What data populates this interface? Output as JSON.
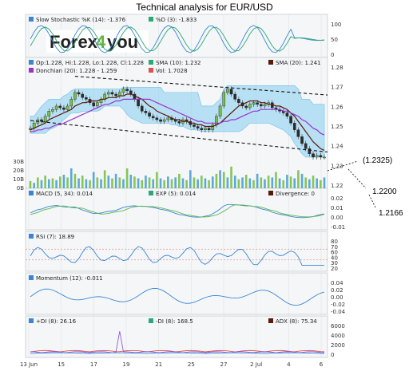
{
  "title": "Technical analysis for EUR/USD",
  "logo": "Forex4you",
  "colors": {
    "candle_up": "#7ac142",
    "candle_down": "#2b2b2b",
    "sma10": "#5a1a0a",
    "sma20": "#9933cc",
    "donchian": "#87cdf0",
    "volume": "#4aa0d8",
    "line_blue": "#3a86d4",
    "rsi_red": "#e06060",
    "panel_bg": "#f4f6f8"
  },
  "panels": {
    "stoch": {
      "legend": [
        "Slow Stochastic %K (14): -1.376",
        "%D (3): -1.833"
      ],
      "ticks": [
        "100",
        "50",
        "0"
      ]
    },
    "price": {
      "legend": [
        "Op:1.228, Hi:1.228, Lo:1.228, Cl:1.228",
        "SMA (10): 1.232",
        "SMA (20): 1.241",
        "Donchian (20): 1.228 - 1.259",
        "Vol: 1.7028"
      ],
      "ticks": [
        "1.28",
        "1.27",
        "1.26",
        "1.25",
        "1.24",
        "1.23",
        "1.22"
      ],
      "vol_ticks": [
        "30B",
        "20B",
        "10B",
        "0B"
      ]
    },
    "macd": {
      "legend": [
        "MACD (5, 34): 0.014",
        "EXP (5): 0.014",
        "Divergence: 0"
      ],
      "ticks": [
        "0.02",
        "0.01",
        "0.00",
        "-0.01"
      ]
    },
    "rsi": {
      "legend": [
        "RSI (7): 18.89"
      ],
      "ticks": [
        "80",
        "70",
        "60",
        "40",
        "30",
        "20"
      ]
    },
    "momentum": {
      "legend": [
        "Momentum (12): -0.011"
      ],
      "ticks": [
        "0.04",
        "0.02",
        "0.00",
        "-0.02",
        "-0.04"
      ]
    },
    "dmi": {
      "legend": [
        "+DI (8): 26.16",
        "-DI (8): 168.5",
        "ADX (8): 75.34"
      ],
      "ticks": [
        "6000",
        "4000",
        "2000",
        "0"
      ]
    }
  },
  "x_labels": [
    "13 Jun",
    "15",
    "17",
    "19",
    "21",
    "25",
    "27",
    "2 Jul",
    "4",
    "6"
  ],
  "annotations": [
    "(1.2325)",
    "1.2200",
    "1.2166"
  ],
  "chart_data": {
    "type": "candlestick",
    "title": "Technical analysis for EUR/USD",
    "x": [
      "13 Jun",
      "15",
      "17",
      "19",
      "21",
      "25",
      "27",
      "2 Jul",
      "4",
      "6"
    ],
    "ylim": [
      1.22,
      1.28
    ],
    "close": [
      1.245,
      1.248,
      1.25,
      1.249,
      1.252,
      1.255,
      1.256,
      1.258,
      1.257,
      1.256,
      1.258,
      1.262,
      1.266,
      1.265,
      1.263,
      1.262,
      1.26,
      1.258,
      1.26,
      1.262,
      1.265,
      1.266,
      1.265,
      1.264,
      1.266,
      1.268,
      1.267,
      1.265,
      1.262,
      1.258,
      1.255,
      1.254,
      1.252,
      1.251,
      1.25,
      1.249,
      1.25,
      1.251,
      1.25,
      1.249,
      1.248,
      1.25,
      1.249,
      1.247,
      1.246,
      1.245,
      1.244,
      1.245,
      1.244,
      1.247,
      1.252,
      1.258,
      1.266,
      1.268,
      1.265,
      1.262,
      1.26,
      1.258,
      1.257,
      1.259,
      1.26,
      1.259,
      1.258,
      1.259,
      1.26,
      1.257,
      1.256,
      1.255,
      1.254,
      1.252,
      1.248,
      1.244,
      1.24,
      1.236,
      1.233,
      1.23,
      1.228,
      1.229,
      1.228,
      1.228
    ],
    "volume": [
      8,
      6,
      12,
      9,
      14,
      10,
      11,
      9,
      13,
      15,
      12,
      22,
      16,
      11,
      14,
      10,
      9,
      18,
      12,
      10,
      20,
      14,
      11,
      16,
      12,
      10,
      22,
      15,
      13,
      11,
      9,
      14,
      12,
      10,
      18,
      11,
      9,
      13,
      10,
      12,
      16,
      11,
      9,
      20,
      12,
      10,
      14,
      11,
      9,
      13,
      16,
      20,
      18,
      12,
      24,
      14,
      10,
      12,
      15,
      11,
      9,
      16,
      12,
      10,
      14,
      12,
      18,
      11,
      9,
      15,
      13,
      11,
      20,
      16,
      12,
      10,
      14,
      11,
      9,
      12
    ],
    "sma10": [
      1.244,
      1.245,
      1.246,
      1.247,
      1.248,
      1.25,
      1.251,
      1.252,
      1.253,
      1.254,
      1.255,
      1.256,
      1.258,
      1.259,
      1.26,
      1.26,
      1.261,
      1.261,
      1.261,
      1.262,
      1.262,
      1.263,
      1.263,
      1.263,
      1.264,
      1.264,
      1.265,
      1.265,
      1.264,
      1.263,
      1.262,
      1.26,
      1.258,
      1.257,
      1.255,
      1.254,
      1.253,
      1.252,
      1.251,
      1.25,
      1.25,
      1.249,
      1.249,
      1.248,
      1.248,
      1.247,
      1.247,
      1.246,
      1.246,
      1.246,
      1.247,
      1.248,
      1.25,
      1.252,
      1.254,
      1.256,
      1.258,
      1.259,
      1.26,
      1.261,
      1.261,
      1.261,
      1.26,
      1.26,
      1.259,
      1.259,
      1.258,
      1.258,
      1.257,
      1.256,
      1.254,
      1.252,
      1.249,
      1.246,
      1.243,
      1.24,
      1.237,
      1.235,
      1.233,
      1.232
    ],
    "sma20": [
      1.243,
      1.243,
      1.244,
      1.244,
      1.245,
      1.245,
      1.246,
      1.247,
      1.247,
      1.248,
      1.249,
      1.25,
      1.251,
      1.252,
      1.253,
      1.254,
      1.255,
      1.256,
      1.257,
      1.258,
      1.259,
      1.259,
      1.26,
      1.261,
      1.261,
      1.262,
      1.262,
      1.262,
      1.262,
      1.262,
      1.262,
      1.262,
      1.262,
      1.261,
      1.26,
      1.259,
      1.258,
      1.257,
      1.256,
      1.255,
      1.254,
      1.253,
      1.252,
      1.251,
      1.25,
      1.249,
      1.249,
      1.248,
      1.248,
      1.248,
      1.248,
      1.248,
      1.249,
      1.249,
      1.25,
      1.25,
      1.251,
      1.252,
      1.253,
      1.254,
      1.255,
      1.255,
      1.256,
      1.256,
      1.256,
      1.256,
      1.256,
      1.256,
      1.255,
      1.255,
      1.254,
      1.253,
      1.252,
      1.25,
      1.249,
      1.247,
      1.245,
      1.244,
      1.242,
      1.241
    ],
    "donchian_upper": [
      1.252,
      1.252,
      1.255,
      1.258,
      1.26,
      1.262,
      1.262,
      1.262,
      1.262,
      1.264,
      1.265,
      1.267,
      1.268,
      1.268,
      1.268,
      1.268,
      1.268,
      1.268,
      1.268,
      1.268,
      1.268,
      1.268,
      1.268,
      1.268,
      1.268,
      1.269,
      1.269,
      1.269,
      1.269,
      1.269,
      1.269,
      1.269,
      1.269,
      1.269,
      1.269,
      1.269,
      1.266,
      1.266,
      1.266,
      1.266,
      1.266,
      1.266,
      1.266,
      1.266,
      1.266,
      1.266,
      1.258,
      1.258,
      1.258,
      1.258,
      1.26,
      1.262,
      1.268,
      1.27,
      1.27,
      1.27,
      1.27,
      1.27,
      1.27,
      1.27,
      1.27,
      1.27,
      1.27,
      1.27,
      1.27,
      1.27,
      1.27,
      1.27,
      1.27,
      1.27,
      1.27,
      1.27,
      1.268,
      1.262,
      1.262,
      1.262,
      1.259,
      1.259,
      1.259,
      1.259
    ],
    "donchian_lower": [
      1.242,
      1.242,
      1.242,
      1.242,
      1.242,
      1.244,
      1.245,
      1.246,
      1.248,
      1.25,
      1.252,
      1.254,
      1.254,
      1.254,
      1.255,
      1.255,
      1.255,
      1.255,
      1.255,
      1.256,
      1.258,
      1.258,
      1.258,
      1.258,
      1.258,
      1.256,
      1.253,
      1.251,
      1.25,
      1.249,
      1.248,
      1.248,
      1.248,
      1.248,
      1.248,
      1.248,
      1.248,
      1.248,
      1.247,
      1.247,
      1.246,
      1.246,
      1.245,
      1.244,
      1.244,
      1.244,
      1.243,
      1.243,
      1.243,
      1.243,
      1.243,
      1.243,
      1.243,
      1.243,
      1.243,
      1.243,
      1.243,
      1.244,
      1.246,
      1.248,
      1.248,
      1.248,
      1.248,
      1.248,
      1.248,
      1.247,
      1.246,
      1.245,
      1.244,
      1.242,
      1.24,
      1.236,
      1.233,
      1.23,
      1.228,
      1.228,
      1.228,
      1.228,
      1.228,
      1.228
    ]
  }
}
